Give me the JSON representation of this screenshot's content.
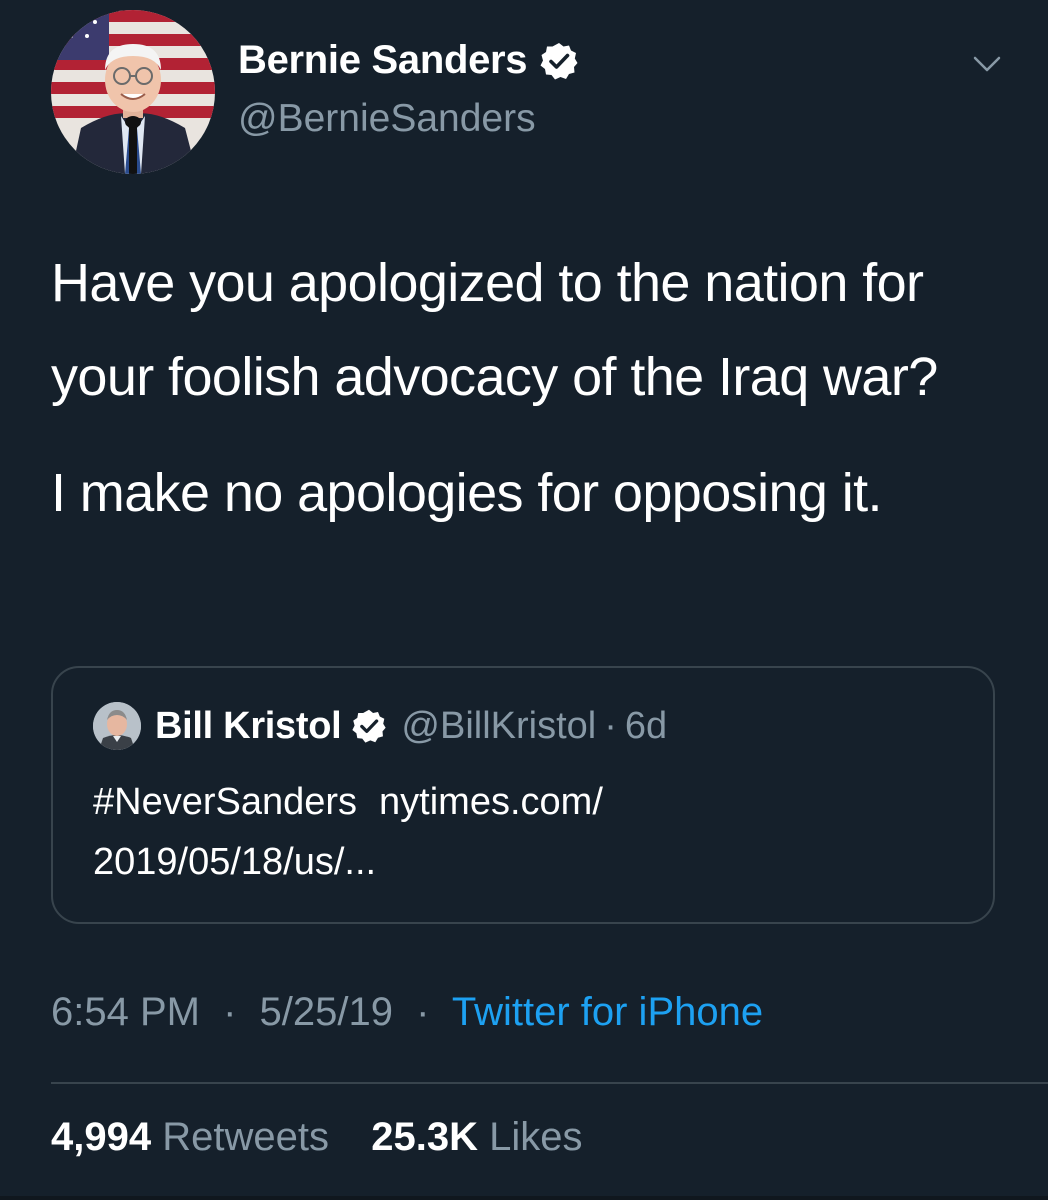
{
  "tweet": {
    "author": {
      "name": "Bernie Sanders",
      "handle": "@BernieSanders",
      "verified": true
    },
    "text": [
      "Have you apologized to the nation for your foolish advocacy of the Iraq war?",
      "I make no apologies for opposing it."
    ],
    "quoted": {
      "name": "Bill Kristol",
      "handle": "@BillKristol",
      "separator": "·",
      "time": "6d",
      "hashtag": "#NeverSanders",
      "link_line1": "nytimes.com/",
      "link_line2": "2019/05/18/us/..."
    },
    "meta": {
      "time": "6:54 PM",
      "date": "5/25/19",
      "separator": "·",
      "source": "Twitter for iPhone"
    },
    "stats": {
      "retweets": "4,994",
      "retweets_label": "Retweets",
      "likes": "25.3K",
      "likes_label": "Likes"
    }
  },
  "colors": {
    "background": "#15202b",
    "text": "#ffffff",
    "secondary": "#8899a6",
    "accent": "#1da1f2",
    "border": "#38444d"
  },
  "icons": [
    "verified-badge-icon",
    "chevron-down-icon"
  ]
}
